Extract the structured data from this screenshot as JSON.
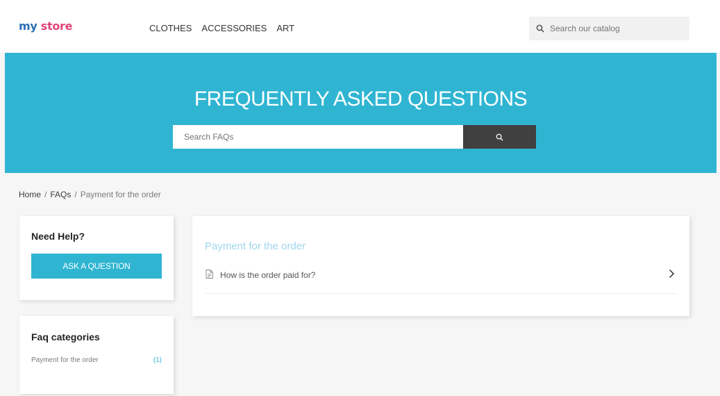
{
  "header": {
    "logo_part1": "my ",
    "logo_part2": "store",
    "nav": [
      "CLOTHES",
      "ACCESSORIES",
      "ART"
    ],
    "search_placeholder": "Search our catalog",
    "search_icon": "search-icon"
  },
  "banner": {
    "title": "FREQUENTLY ASKED QUESTIONS",
    "search_placeholder": "Search FAQs",
    "search_icon": "search-icon",
    "background": "#2fb5d2"
  },
  "breadcrumb": {
    "home": "Home",
    "faqs": "FAQs",
    "current": "Payment for the order",
    "separator": "/"
  },
  "sidebar": {
    "help_title": "Need Help?",
    "ask_button": "ASK A QUESTION",
    "categories_title": "Faq categories",
    "categories": [
      {
        "name": "Payment for the order",
        "count": "(1)"
      }
    ]
  },
  "main": {
    "category_title": "Payment for the order",
    "questions": [
      {
        "text": "How is the order paid for?",
        "icon": "document-icon",
        "arrow": "chevron-right-icon"
      }
    ]
  },
  "colors": {
    "accent": "#2fb5d2",
    "dark_button": "#404040",
    "logo_blue": "#2c6fb4",
    "logo_pink": "#e0457b"
  }
}
